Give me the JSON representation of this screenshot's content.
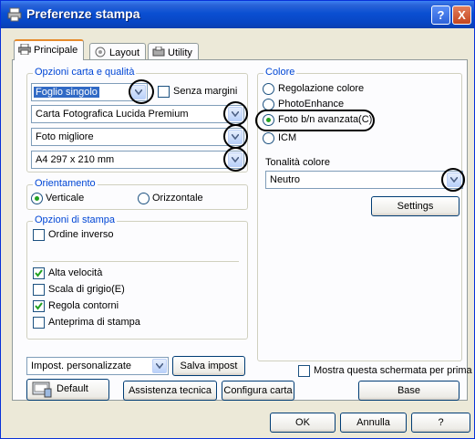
{
  "window": {
    "title": "Preferenze stampa",
    "help_glyph": "?",
    "close_glyph": "X"
  },
  "tabs": [
    {
      "label": "Principale",
      "active": true
    },
    {
      "label": "Layout",
      "active": false
    },
    {
      "label": "Utility",
      "active": false
    }
  ],
  "paper_options": {
    "legend": "Opzioni carta e qualità",
    "source": "Foglio singolo",
    "borderless_label": "Senza margini",
    "borderless_checked": false,
    "media_type": "Carta Fotografica Lucida Premium",
    "quality": "Foto migliore",
    "size": "A4 297 x 210 mm"
  },
  "orientation": {
    "legend": "Orientamento",
    "options": [
      {
        "label": "Verticale",
        "selected": true
      },
      {
        "label": "Orizzontale",
        "selected": false
      }
    ]
  },
  "print_options": {
    "legend": "Opzioni di stampa",
    "items": [
      {
        "label": "Ordine inverso",
        "checked": false
      },
      {
        "label": "Alta velocità",
        "checked": true
      },
      {
        "label": "Scala di grigio(E)",
        "checked": false
      },
      {
        "label": "Regola contorni",
        "checked": true
      },
      {
        "label": "Anteprima di stampa",
        "checked": false
      }
    ]
  },
  "color": {
    "legend": "Colore",
    "options": [
      {
        "label": "Regolazione colore",
        "selected": false
      },
      {
        "label": "PhotoEnhance",
        "selected": false
      },
      {
        "label": "Foto b/n avanzata(C)",
        "selected": true
      },
      {
        "label": "ICM",
        "selected": false
      }
    ],
    "tone_label": "Tonalità colore",
    "tone_value": "Neutro",
    "settings_button": "Settings"
  },
  "bottom": {
    "custom_combo": "Impost. personalizzate",
    "save_button": "Salva impost",
    "show_screen_label": "Mostra questa schermata per prima",
    "show_screen_checked": false,
    "default_button": "Default",
    "assist_button": "Assistenza tecnica",
    "config_button": "Configura carta",
    "base_button": "Base"
  },
  "dialog_buttons": {
    "ok": "OK",
    "cancel": "Annulla",
    "help": "?"
  },
  "colors": {
    "title_blue": "#0a4fd2",
    "legend_blue": "#0046d5",
    "selection": "#316ac5",
    "radio_green": "#21a121"
  }
}
